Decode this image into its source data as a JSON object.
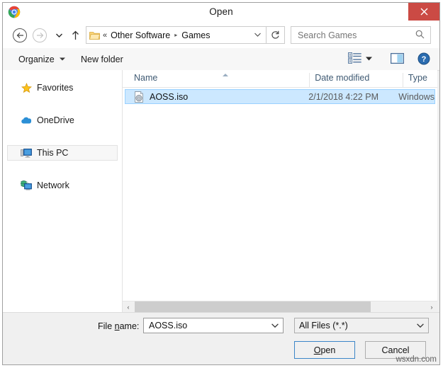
{
  "window": {
    "title": "Open",
    "app_icon": "chrome-icon",
    "close_label": "✕"
  },
  "navbar": {
    "back_icon": "back-arrow-icon",
    "forward_icon": "forward-arrow-icon",
    "recent_icon": "chevron-down-icon",
    "up_icon": "up-arrow-icon",
    "breadcrumb": {
      "folder_icon": "folder-icon",
      "leading_separator": "«",
      "segments": [
        "Other Software",
        "Games"
      ],
      "separator": "▸",
      "dropdown_icon": "chevron-down-icon"
    },
    "refresh_icon": "refresh-icon",
    "search": {
      "placeholder": "Search Games",
      "value": "",
      "icon": "search-icon"
    }
  },
  "toolbar": {
    "organize_label": "Organize",
    "organize_caret": "▼",
    "new_folder_label": "New folder",
    "view_icon": "list-view-icon",
    "view_caret": "▼",
    "preview_pane_icon": "preview-pane-icon",
    "help_icon": "help-icon"
  },
  "sidebar": {
    "items": [
      {
        "label": "Favorites",
        "icon": "star-icon",
        "selected": false
      },
      {
        "label": "OneDrive",
        "icon": "cloud-icon",
        "selected": false
      },
      {
        "label": "This PC",
        "icon": "computer-icon",
        "selected": true
      },
      {
        "label": "Network",
        "icon": "network-icon",
        "selected": false
      }
    ]
  },
  "filelist": {
    "columns": [
      "Name",
      "Date modified",
      "Type"
    ],
    "sort_column": "Name",
    "sort_direction": "ascending",
    "rows": [
      {
        "name": "AOSS.iso",
        "date_modified": "2/1/2018 4:22 PM",
        "type": "Windows",
        "icon": "iso-disc-image-icon",
        "selected": true
      }
    ],
    "hscroll": {
      "left_arrow": "‹",
      "right_arrow": "›"
    }
  },
  "footer": {
    "filename_label_pre": "File ",
    "filename_label_accel": "n",
    "filename_label_post": "ame:",
    "filename_value": "AOSS.iso",
    "filename_placeholder": "File name",
    "filename_caret": "∨",
    "filter_value": "All Files (*.*)",
    "filter_caret": "∨",
    "open_label_accel": "O",
    "open_label_rest": "pen",
    "cancel_label": "Cancel"
  },
  "watermark": {
    "text": "wsxdn.com"
  },
  "colors": {
    "close_red": "#cb4a44",
    "selection_blue": "#cce8ff",
    "selection_border": "#99d1ff",
    "focus_border": "#3c86c8",
    "column_header_text": "#3f5a73"
  }
}
